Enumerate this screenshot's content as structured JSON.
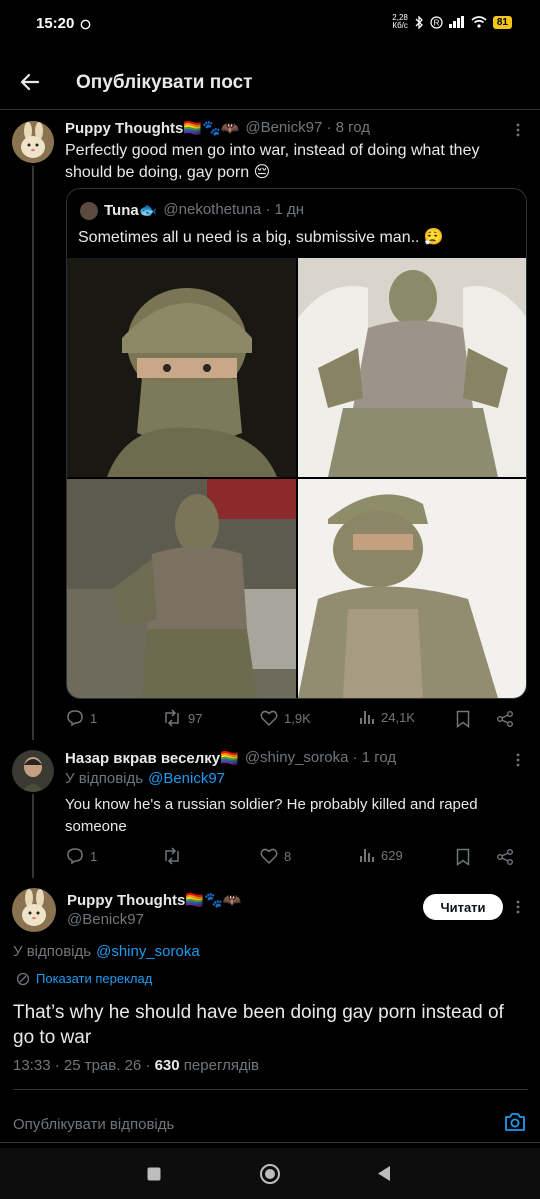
{
  "status": {
    "time": "15:20",
    "speed": "2,28 Кб/с",
    "battery": "81"
  },
  "appbar": {
    "title": "Опублікувати пост"
  },
  "post1": {
    "name": "Puppy Thoughts🏳️‍🌈🐾🦇",
    "handle": "@Benick97 · 8 год",
    "text": "Perfectly good men go into war, instead of doing what they should be doing, gay porn 😔",
    "quote": {
      "name": "Tuna🐟",
      "handle": "@nekothetuna · 1 дн",
      "text": "Sometimes all u need is a big, submissive man.. 😮‍💨"
    },
    "actions": {
      "replies": "1",
      "reposts": "97",
      "likes": "1,9K",
      "views": "24,1K"
    }
  },
  "post2": {
    "name": "Назар вкрав веселку🏳️‍🌈",
    "handle": "@shiny_soroka · 1 год",
    "reply_prefix": "У відповідь",
    "reply_to": "@Benick97",
    "text": "You know he's a russian soldier? He probably killed and raped someone",
    "actions": {
      "replies": "1",
      "reposts": "",
      "likes": "8",
      "views": "629"
    }
  },
  "main": {
    "name": "Puppy Thoughts🏳️‍🌈🐾🦇",
    "handle": "@Benick97",
    "follow_label": "Читати",
    "reply_prefix": "У відповідь",
    "reply_to": "@shiny_soroka",
    "translate": "Показати переклад",
    "text": "That’s why he should have been doing gay porn instead of go to war",
    "meta_time": "13:33 · 25 трав. 26 · ",
    "meta_views": "630",
    "meta_views_label": " переглядів"
  },
  "composer": {
    "placeholder": "Опублікувати відповідь"
  },
  "colors": {
    "accent": "#1d9bf0",
    "background": "#000000",
    "muted": "#71767b"
  }
}
